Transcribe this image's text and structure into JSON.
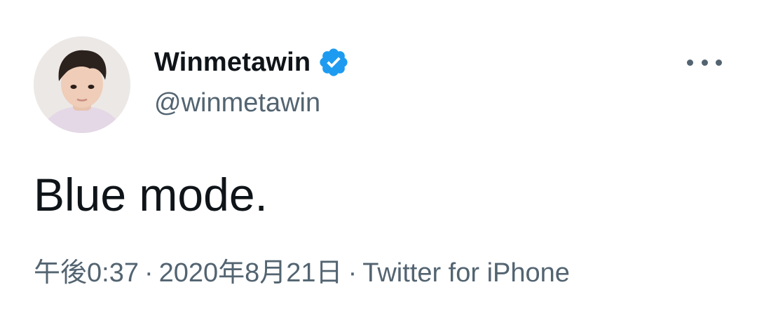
{
  "author": {
    "display_name": "Winmetawin",
    "handle": "@winmetawin",
    "avatar": "profile-photo",
    "verified_icon": "verified-badge-icon",
    "verified_color": "#1d9bf0"
  },
  "more_menu": {
    "icon": "more-horizontal-icon"
  },
  "tweet": {
    "text": "Blue mode."
  },
  "meta": {
    "time": "午後0:37",
    "separator1": "·",
    "date": "2020年8月21日",
    "separator2": "·",
    "source": "Twitter for iPhone"
  },
  "colors": {
    "primary_text": "#0f1419",
    "secondary_text": "#536471",
    "background": "#ffffff"
  }
}
